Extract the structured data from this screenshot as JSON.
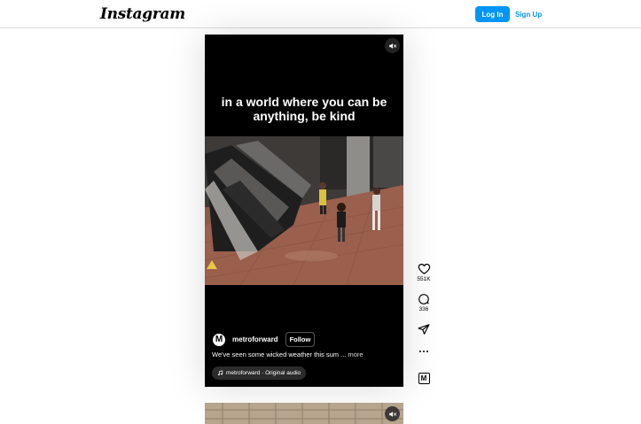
{
  "header": {
    "logo": "Instagram",
    "login_label": "Log In",
    "signup_label": "Sign Up"
  },
  "reel": {
    "caption_overlay": "in a world where you can be anything, be kind",
    "author": {
      "avatar_letter": "M",
      "username": "metroforward",
      "follow_label": "Follow"
    },
    "description": "We've seen some wicked weather this sum",
    "description_ellipsis": "...",
    "more_label": "more",
    "audio": "metroforward · Original audio",
    "muted": true
  },
  "actions": {
    "likes": "551K",
    "comments": "336",
    "owner_badge": "M"
  },
  "colors": {
    "accent": "#0095f6",
    "reel_bg": "#000000"
  },
  "icons": [
    "speaker-muted-icon",
    "heart-icon",
    "comment-icon",
    "share-icon",
    "more-icon",
    "music-note-icon"
  ]
}
